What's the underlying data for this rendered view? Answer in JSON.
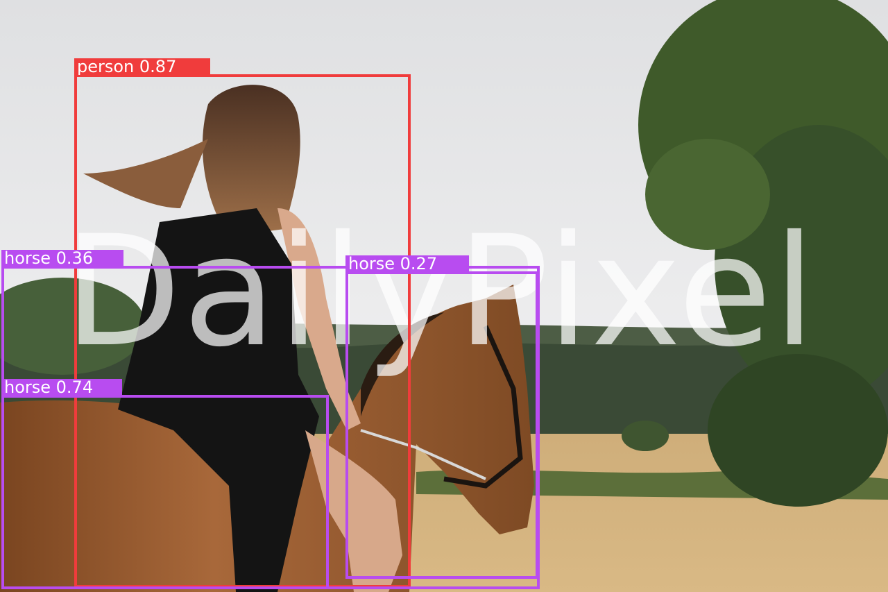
{
  "watermark": "DailyPixel",
  "colors": {
    "person": "#f03c3c",
    "horse": "#b84cf0",
    "sky": "#e6e7e9",
    "field": "#d4b27c",
    "tree": "#3f5a2a",
    "horse_coat": "#8a4f25",
    "dress": "#141414"
  },
  "detections": [
    {
      "id": "person",
      "class": "person",
      "score": "0.87",
      "label": "person 0.87",
      "color": "#f03c3c"
    },
    {
      "id": "horse-a",
      "class": "horse",
      "score": "0.36",
      "label": "horse 0.36",
      "color": "#b84cf0"
    },
    {
      "id": "horse-b",
      "class": "horse",
      "score": "0.27",
      "label": "horse 0.27",
      "color": "#b84cf0"
    },
    {
      "id": "horse-c",
      "class": "horse",
      "score": "0.74",
      "label": "horse 0.74",
      "color": "#b84cf0"
    }
  ]
}
